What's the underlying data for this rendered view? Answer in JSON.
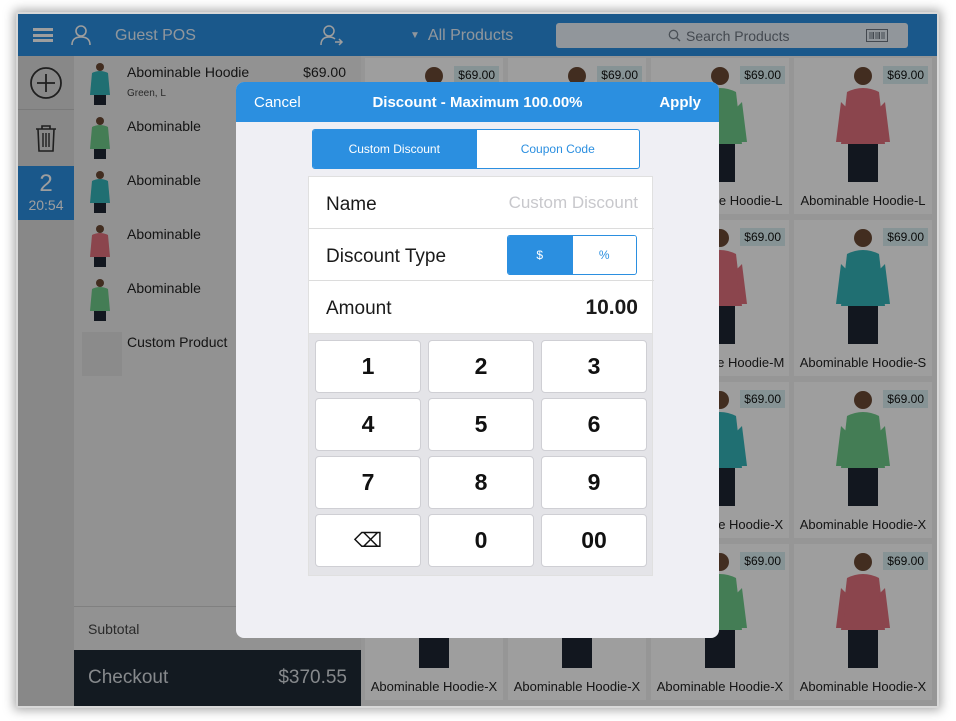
{
  "topbar": {
    "customer_name": "Guest POS",
    "category": "All Products",
    "search_placeholder": "Search Products"
  },
  "rail": {
    "order_number": "2",
    "order_time": "20:54"
  },
  "cart": {
    "items": [
      {
        "name": "Abominable Hoodie",
        "variant": "Green, L",
        "price": "$69.00",
        "color": "#35b3b8"
      },
      {
        "name": "Abominable",
        "variant": "",
        "price": "",
        "color": "#6fca8a"
      },
      {
        "name": "Abominable",
        "variant": "",
        "price": "",
        "color": "#35b3b8"
      },
      {
        "name": "Abominable",
        "variant": "",
        "price": "",
        "color": "#e0707c"
      },
      {
        "name": "Abominable",
        "variant": "",
        "price": "",
        "color": "#6fca8a"
      },
      {
        "name": "Custom Product",
        "variant": "",
        "price": "",
        "color": "#e1e1e1"
      }
    ],
    "subtotal_label": "Subtotal",
    "checkout_label": "Checkout",
    "checkout_total": "$370.55"
  },
  "products": {
    "columns": [
      {
        "tiles": [
          {
            "name": "",
            "price": "$69.00",
            "color": "#e0707c"
          },
          {
            "name": "",
            "price": "",
            "color": "#e0707c"
          },
          {
            "name": "",
            "price": "",
            "color": "#35b3b8"
          },
          {
            "name": "Abominable Hoodie-X",
            "price": "",
            "color": "#e0707c"
          }
        ]
      },
      {
        "tiles": [
          {
            "name": "",
            "price": "$69.00",
            "color": "#6fca8a"
          },
          {
            "name": "",
            "price": "",
            "color": "#6fca8a"
          },
          {
            "name": "",
            "price": "",
            "color": "#e0707c"
          },
          {
            "name": "Abominable Hoodie-X",
            "price": "",
            "color": "#35b3b8"
          }
        ]
      },
      {
        "tiles": [
          {
            "name": "Abominable Hoodie-L",
            "price": "$69.00",
            "color": "#6fca8a"
          },
          {
            "name": "Abominable Hoodie-M",
            "price": "$69.00",
            "color": "#e0707c"
          },
          {
            "name": "Abominable Hoodie-X",
            "price": "$69.00",
            "color": "#35b3b8"
          },
          {
            "name": "Abominable Hoodie-X",
            "price": "$69.00",
            "color": "#6fca8a"
          }
        ]
      },
      {
        "tiles": [
          {
            "name": "Abominable Hoodie-L",
            "price": "$69.00",
            "color": "#e0707c"
          },
          {
            "name": "Abominable Hoodie-S",
            "price": "$69.00",
            "color": "#35b3b8"
          },
          {
            "name": "Abominable Hoodie-X",
            "price": "$69.00",
            "color": "#6fca8a"
          },
          {
            "name": "Abominable Hoodie-X",
            "price": "$69.00",
            "color": "#e0707c"
          }
        ]
      }
    ]
  },
  "modal": {
    "cancel_label": "Cancel",
    "title": "Discount - Maximum 100.00%",
    "apply_label": "Apply",
    "tabs": {
      "custom": "Custom Discount",
      "coupon": "Coupon Code"
    },
    "name_label": "Name",
    "name_placeholder": "Custom Discount",
    "type_label": "Discount Type",
    "type_options": {
      "fixed": "$",
      "percent": "%"
    },
    "amount_label": "Amount",
    "amount_value": "10.00",
    "keys": [
      "1",
      "2",
      "3",
      "4",
      "5",
      "6",
      "7",
      "8",
      "9",
      "⌫",
      "0",
      "00"
    ]
  },
  "colors": {
    "accent": "#2b8fe0",
    "checkout_bg": "#1f2a36"
  }
}
